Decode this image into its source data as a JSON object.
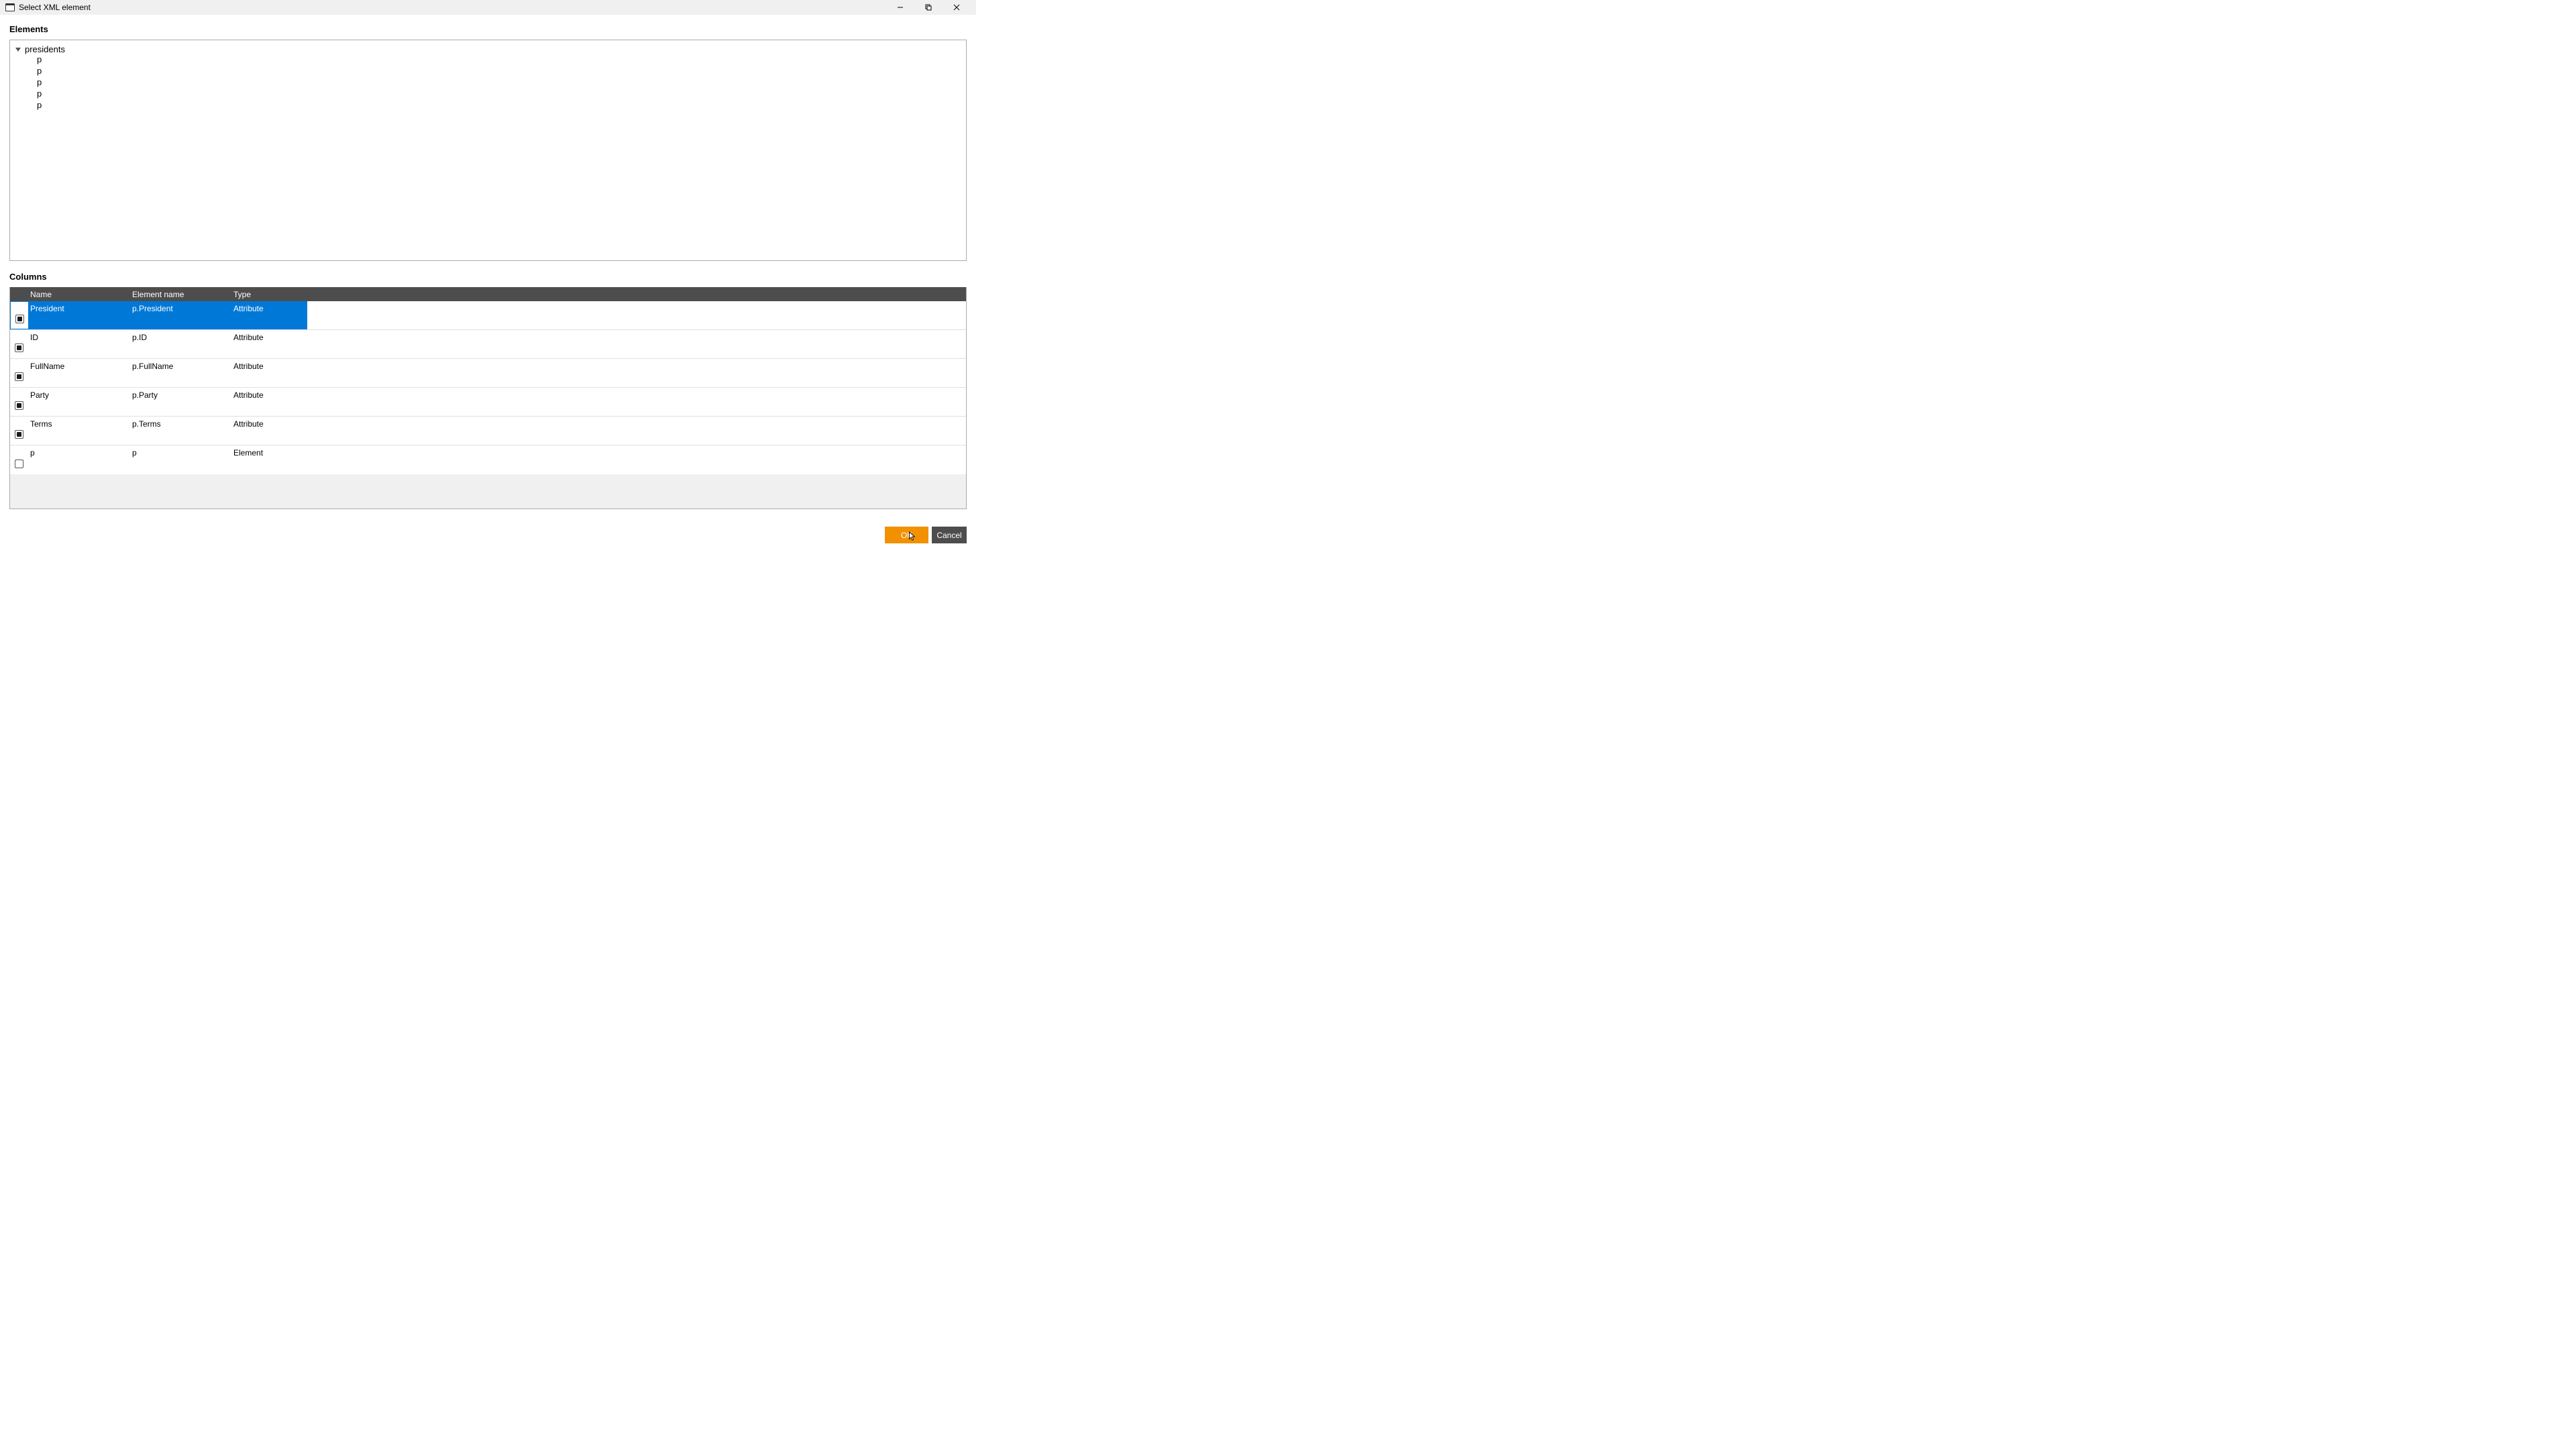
{
  "window": {
    "title": "Select XML element"
  },
  "elements": {
    "label": "Elements",
    "root": "presidents",
    "children": [
      "p",
      "p",
      "p",
      "p",
      "p"
    ]
  },
  "columns": {
    "label": "Columns",
    "headers": {
      "name": "Name",
      "element_name": "Element name",
      "type": "Type"
    },
    "rows": [
      {
        "checked": true,
        "selected": true,
        "name": "President",
        "element_name": "p.President",
        "type": "Attribute"
      },
      {
        "checked": true,
        "selected": false,
        "name": "ID",
        "element_name": "p.ID",
        "type": "Attribute"
      },
      {
        "checked": true,
        "selected": false,
        "name": "FullName",
        "element_name": "p.FullName",
        "type": "Attribute"
      },
      {
        "checked": true,
        "selected": false,
        "name": "Party",
        "element_name": "p.Party",
        "type": "Attribute"
      },
      {
        "checked": true,
        "selected": false,
        "name": "Terms",
        "element_name": "p.Terms",
        "type": "Attribute"
      },
      {
        "checked": false,
        "selected": false,
        "name": "p",
        "element_name": "p",
        "type": "Element"
      }
    ]
  },
  "buttons": {
    "ok": "OK",
    "cancel": "Cancel"
  }
}
